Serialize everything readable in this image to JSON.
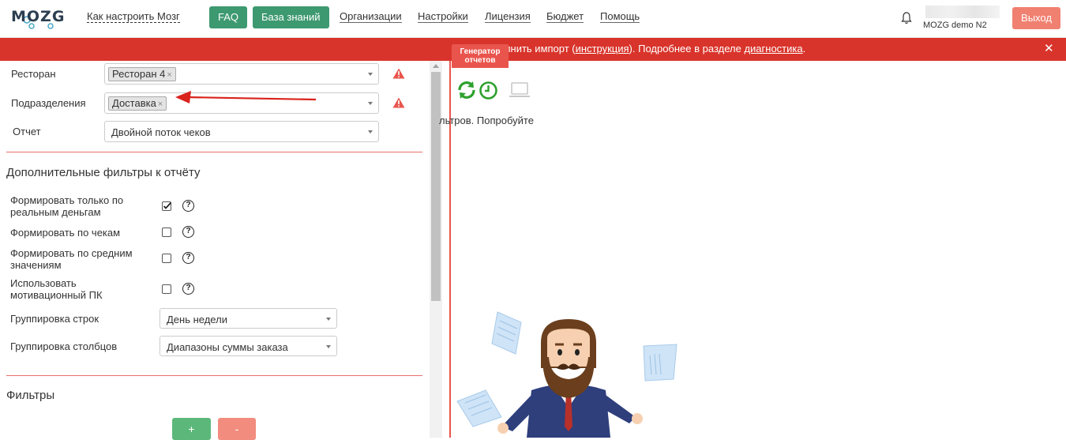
{
  "header": {
    "logo_text": "MOZG",
    "nav": {
      "how_to": "Как настроить Мозг",
      "faq": "FAQ",
      "knowledge": "База знаний",
      "orgs": "Организации",
      "settings": "Настройки",
      "license": "Лицензия",
      "budget": "Бюджет",
      "help": "Помощь"
    },
    "username": "MOZG demo N2",
    "logout": "Выход"
  },
  "notice": {
    "text_before": "олнить импорт (",
    "link_instruction": "инструкция",
    "text_middle": "). Подробнее в разделе ",
    "link_diagnostics": "диагностика",
    "text_after": ".",
    "close": "✕"
  },
  "generator_tag": {
    "line1": "Генератор",
    "line2": "отчетов"
  },
  "form": {
    "restaurant": {
      "label": "Ресторан",
      "tag": "Ресторан 4"
    },
    "divisions": {
      "label": "Подразделения",
      "tag": "Доставка"
    },
    "report": {
      "label": "Отчет",
      "value": "Двойной поток чеков"
    },
    "tag_remove": "×"
  },
  "extra_filters": {
    "title": "Дополнительные фильтры к отчёту",
    "options": [
      {
        "label_line1": "Формировать только по",
        "label_line2": "реальным деньгам",
        "checked": true
      },
      {
        "label_line1": "Формировать по чекам",
        "label_line2": "",
        "checked": false
      },
      {
        "label_line1": "Формировать по средним",
        "label_line2": "значениям",
        "checked": false
      },
      {
        "label_line1": "Использовать",
        "label_line2": "мотивационный ПК",
        "checked": false
      }
    ],
    "help_glyph": "?",
    "row_grouping": {
      "label": "Группировка строк",
      "value": "День недели"
    },
    "col_grouping": {
      "label": "Группировка столбцов",
      "value": "Диапазоны суммы заказа"
    }
  },
  "filters": {
    "title": "Фильтры",
    "add": "+",
    "remove": "-"
  },
  "right": {
    "hint": "льтров. Попробуйте",
    "icons": [
      "refresh-icon",
      "clock-icon",
      "laptop-icon"
    ]
  },
  "colors": {
    "brand_green": "#3d9970",
    "notice_red": "#d9342b",
    "logout": "#f08070",
    "accent_red": "#e9554d",
    "icon_green": "#2ea02e"
  }
}
